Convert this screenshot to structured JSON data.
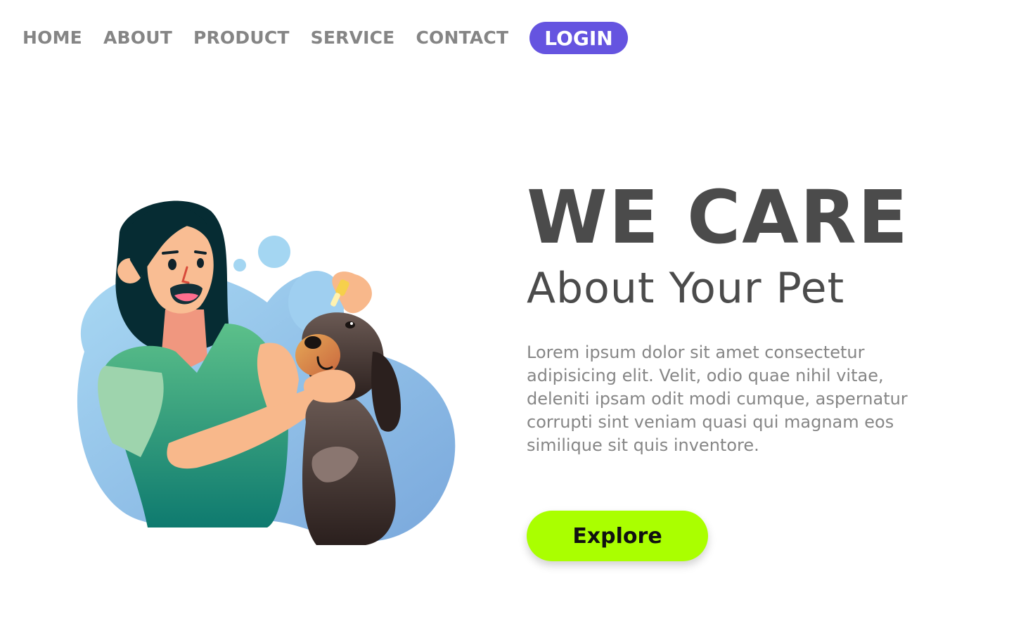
{
  "nav": {
    "items": [
      {
        "label": "HOME"
      },
      {
        "label": "ABOUT"
      },
      {
        "label": "PRODUCT"
      },
      {
        "label": "SERVICE"
      },
      {
        "label": "CONTACT"
      }
    ],
    "login_label": "LOGIN"
  },
  "hero": {
    "title": "WE CARE",
    "subtitle": "About Your Pet",
    "body": "Lorem ipsum dolor sit amet consectetur adipisicing elit. Velit, odio quae nihil vitae, deleniti ipsam odit modi cumque, aspernatur corrupti sint veniam quasi qui magnam eos similique sit quis inventore.",
    "cta_label": "Explore"
  },
  "colors": {
    "nav_text": "#858585",
    "login_bg": "#6554e0",
    "heading": "#4b4b4b",
    "body_text": "#868686",
    "cta_bg": "#aaff00"
  },
  "illustration": {
    "subject": "woman-giving-dog-eye-drops"
  }
}
